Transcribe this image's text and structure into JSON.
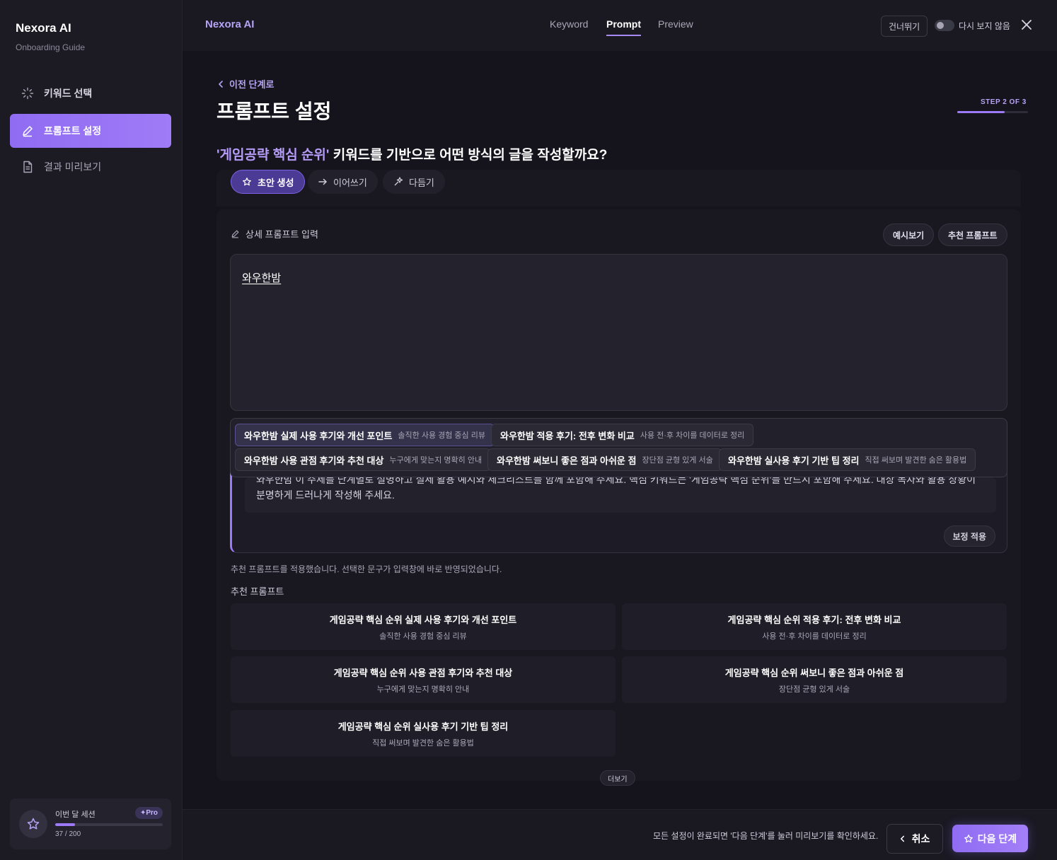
{
  "app": {
    "name": "Nexora AI",
    "subtitle": "Onboarding Guide"
  },
  "sidebar": {
    "items": [
      {
        "label": "키워드 선택",
        "icon": "loader-icon",
        "state": "done"
      },
      {
        "label": "프롬프트 설정",
        "icon": "pencil-icon",
        "state": "active"
      },
      {
        "label": "결과 미리보기",
        "icon": "document-icon",
        "state": "pending"
      }
    ],
    "session": {
      "label": "이번 달 세션",
      "badge": "✦Pro",
      "count": "37 / 200",
      "used": 37,
      "limit": 200
    }
  },
  "topbar": {
    "brand": "Nexora AI",
    "tabs": [
      {
        "label": "Keyword",
        "active": false
      },
      {
        "label": "Prompt",
        "active": true
      },
      {
        "label": "Preview",
        "active": false
      }
    ],
    "skip_label": "건너뛰기",
    "dont_show_label": "다시 보지 않음",
    "dont_show_enabled": false
  },
  "main": {
    "back_label": "이전 단계로",
    "title": "프롬프트 설정",
    "step_label": "STEP 2 OF 3",
    "step_current": 2,
    "step_total": 3,
    "question_keyword": "'게임공략 핵심 순위'",
    "question_rest": " 키워드를 기반으로 어떤 방식의 글을 작성할까요?",
    "modes": [
      {
        "label": "초안 생성",
        "icon": "star-icon",
        "active": true
      },
      {
        "label": "이어쓰기",
        "icon": "arrow-right-icon",
        "active": false
      },
      {
        "label": "다듬기",
        "icon": "sparkle-icon",
        "active": false
      }
    ],
    "detail_label": "상세 프롬프트 입력",
    "example_button": "예시보기",
    "recommend_button": "추천 프롬프트",
    "input_value": "와우한밤",
    "suggestions": [
      {
        "title": "와우한밤 실제 사용 후기와 개선 포인트",
        "desc": "솔직한 사용 경험 중심 리뷰"
      },
      {
        "title": "와우한밤 적용 후기: 전후 변화 비교",
        "desc": "사용 전·후 차이를 데이터로 정리"
      },
      {
        "title": "와우한밤 사용 관점 후기와 추천 대상",
        "desc": "누구에게 맞는지 명확히 안내"
      },
      {
        "title": "와우한밤 써보니 좋은 점과 아쉬운 점",
        "desc": "장단점 균형 있게 서술"
      },
      {
        "title": "와우한밤 실사용 후기 기반 팁 정리",
        "desc": "직접 써보며 발견한 숨은 활용법"
      }
    ],
    "refine_text_line1": "와우한밤 이 주제를 단계별로 설명하고 실제 활용 예시와 체크리스트를 함께 포함해 주세요. 핵심 키워드는 '게임공략 핵심 순위'를 반드시 포함해 주세요. 대상 독자와 활용 상황이",
    "refine_text_line2": "분명하게 드러나게 작성해 주세요.",
    "refine_apply": "보정 적용",
    "applied_message": "추천 프롬프트를 적용했습니다. 선택한 문구가 입력창에 바로 반영되었습니다.",
    "recommend_title": "추천 프롬프트",
    "recommendations": [
      {
        "title": "게임공략 핵심 순위 실제 사용 후기와 개선 포인트",
        "desc": "솔직한 사용 경험 중심 리뷰"
      },
      {
        "title": "게임공략 핵심 순위 적용 후기: 전후 변화 비교",
        "desc": "사용 전·후 차이를 데이터로 정리"
      },
      {
        "title": "게임공략 핵심 순위 사용 관점 후기와 추천 대상",
        "desc": "누구에게 맞는지 명확히 안내"
      },
      {
        "title": "게임공략 핵심 순위 써보니 좋은 점과 아쉬운 점",
        "desc": "장단점 균형 있게 서술"
      },
      {
        "title": "게임공략 핵심 순위 실사용 후기 기반 팁 정리",
        "desc": "직접 써보며 발견한 숨은 활용법"
      }
    ],
    "more_label": "더보기"
  },
  "footer": {
    "message": "모든 설정이 완료되면 '다음 단계'를 눌러 미리보기를 확인하세요.",
    "cancel_label": "취소",
    "next_label": "다음 단계"
  },
  "colors": {
    "accent": "#9d7af5",
    "accent_text": "#b6a3f5",
    "background": "#15141c",
    "sidebar": "#1c1b24"
  }
}
